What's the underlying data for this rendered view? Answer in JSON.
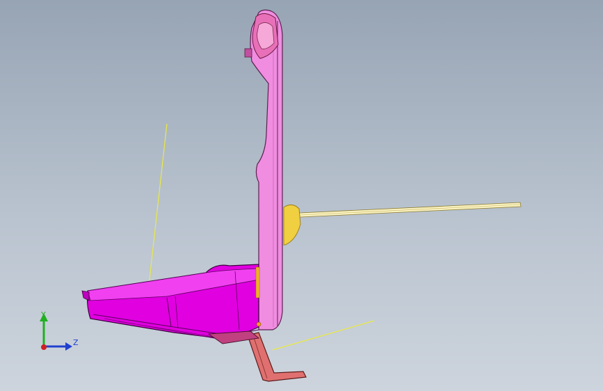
{
  "viewport": {
    "background_top": "#97a4b4",
    "background_bottom": "#cdd4dd"
  },
  "model": {
    "part_color": "#f08de0",
    "body_color": "#e000e0",
    "accent_color": "#f0e060",
    "bracket_color": "#e07070",
    "guide_line_color": "#eaea40"
  },
  "triad": {
    "y_label": "Y",
    "z_label": "Z",
    "y_color": "#20b020",
    "z_color": "#2040d0",
    "x_color": "#d02020"
  }
}
